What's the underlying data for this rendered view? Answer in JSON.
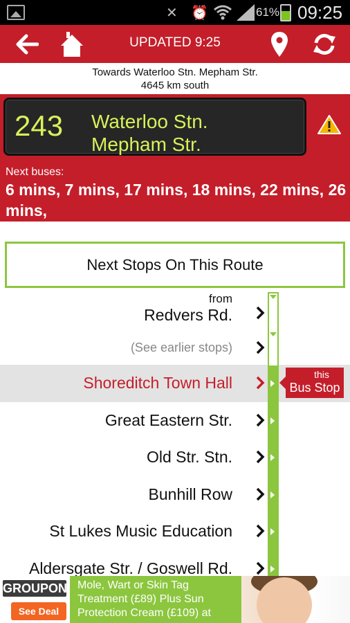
{
  "status_bar": {
    "battery": "61%",
    "time": "09:25"
  },
  "toolbar": {
    "updated": "UPDATED 9:25"
  },
  "direction": {
    "towards": "Towards Waterloo Stn. Mepham Str.",
    "distance": "4645 km south"
  },
  "route": {
    "number": "243",
    "destination_line1": "Waterloo Stn.",
    "destination_line2": "Mepham Str."
  },
  "next_buses": {
    "label": "Next buses:",
    "times": "6 mins, 7 mins, 17 mins, 18 mins, 22 mins, 26 mins,"
  },
  "next_stops": {
    "title": "Next Stops On This Route",
    "from_label": "from",
    "stops": [
      {
        "name": "Redvers Rd."
      },
      {
        "name": "(See earlier stops)"
      },
      {
        "name": "Shoreditch Town Hall"
      },
      {
        "name": "Great Eastern Str."
      },
      {
        "name": "Old Str. Stn."
      },
      {
        "name": "Bunhill Row"
      },
      {
        "name": "St Lukes Music Education"
      },
      {
        "name": "Aldersgate Str. / Goswell Rd."
      }
    ],
    "this_stop_line1": "this",
    "this_stop_line2": "Bus Stop"
  },
  "ad": {
    "brand": "GROUPON",
    "cta": "See Deal",
    "text": "Mole, Wart or Skin Tag Treatment (£89) Plus Sun Protection Cream (£109) at"
  },
  "colors": {
    "primary_red": "#c41e2a",
    "route_green": "#8cc63f",
    "led_text": "#d7f25a"
  }
}
